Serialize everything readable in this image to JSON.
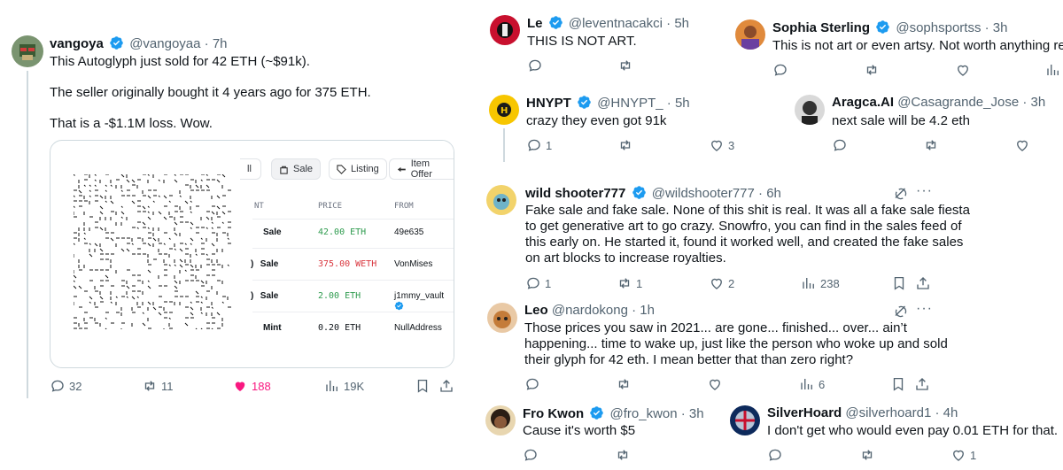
{
  "colors": {
    "verified": "#1d9bf0",
    "like_active": "#f91880",
    "text": "#0f1419",
    "muted": "#536471",
    "green": "#2e9b4e",
    "red": "#d9363e"
  },
  "main": {
    "author": "vangoya",
    "handle": "@vangoyaa",
    "time": "· 7h",
    "lines": [
      "This Autoglyph just sold for 42 ETH (~$91k).",
      "The seller originally bought it 4 years ago for 375 ETH.",
      "That is a -$1.1M loss. Wow."
    ],
    "embed": {
      "tabs": [
        "ll",
        "Sale",
        "Listing",
        "Item Offer"
      ],
      "columns": [
        "NT",
        "PRICE",
        "FROM"
      ],
      "rows": [
        {
          "event": "Sale",
          "price": "42.00 ETH",
          "from": "49e635"
        },
        {
          "event": "Sale",
          "price": "375.00 WETH",
          "from": "VonMises"
        },
        {
          "event": "Sale",
          "price": "2.00 ETH",
          "from": "j1mmy_vault"
        },
        {
          "event": "Mint",
          "price": "0.20 ETH",
          "from": "NullAddress"
        }
      ]
    },
    "stats": {
      "replies": "32",
      "reposts": "11",
      "likes": "188",
      "views": "19K"
    }
  },
  "replies": [
    {
      "author": "Le",
      "handle": "@leventnacakci",
      "time": "· 5h",
      "text": [
        "THIS IS NOT ART."
      ]
    },
    {
      "author": "Sophia Sterling",
      "handle": "@sophsportss",
      "time": "· 3h",
      "text": [
        "This is not art or even artsy. Not worth anything really"
      ]
    },
    {
      "author": "HNYPT",
      "handle": "@HNYPT_",
      "time": "· 5h",
      "text": [
        "crazy they even got 91k"
      ],
      "replies": "1",
      "likes": "3"
    },
    {
      "author": "Aragca.AI",
      "handle": "@Casagrande_Jose",
      "time": "· 3h",
      "text": [
        "next sale will be 4.2 eth"
      ]
    },
    {
      "author": "wild shooter777",
      "handle": "@wildshooter777",
      "time": "· 6h",
      "text": [
        "Fake sale and fake sale.  None of this shit is real.  It was all a fake sale fiesta",
        "to get generative art to go crazy.  Snowfro, you can find in the sales feed of",
        "this early on.  He started it, found it worked well, and created the fake sales",
        "on art blocks to increase royalties."
      ],
      "replies": "1",
      "reposts": "1",
      "likes": "2",
      "views": "238"
    },
    {
      "author": "Leo",
      "handle": "@nardokong",
      "time": "· 1h",
      "text": [
        "Those prices you saw in 2021... are gone... finished... over... ain’t",
        "happening... time to wake up, just like the person who woke up and sold",
        "their glyph for 42 eth. I mean better that than zero right?"
      ],
      "views": "6"
    },
    {
      "author": "Fro Kwon",
      "handle": "@fro_kwon",
      "time": "· 3h",
      "text": [
        "Cause it's worth $5"
      ]
    },
    {
      "author": "SilverHoard",
      "handle": "@silverhoard1",
      "time": "· 4h",
      "text": [
        "I don't get who would even pay 0.01 ETH for that."
      ],
      "likes": "1"
    }
  ]
}
